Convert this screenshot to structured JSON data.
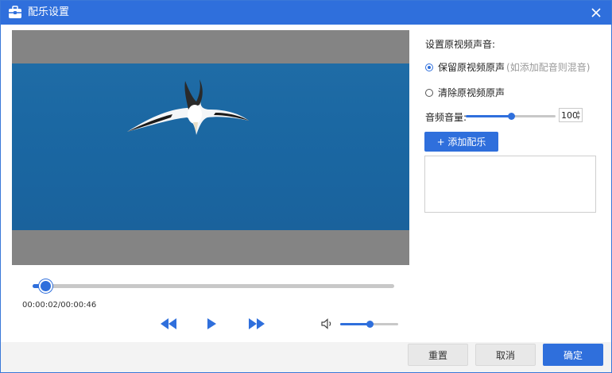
{
  "window": {
    "title": "配乐设置",
    "accent_color": "#2f6fdc"
  },
  "player": {
    "time_label": "00:00:02/00:00:46",
    "progress_fraction": 0.035,
    "volume_fraction": 0.5,
    "icons": [
      "rewind-icon",
      "play-icon",
      "fast-forward-icon",
      "volume-icon"
    ]
  },
  "settings": {
    "section_title": "设置原视频声音:",
    "option_keep": "保留原视频原声",
    "option_keep_hint": "(如添加配音则混音)",
    "option_clear": "清除原视频原声",
    "selected_option": "option_keep",
    "volume_label": "音频音量:",
    "volume_value": "100",
    "volume_fraction": 0.5,
    "add_music_label": "+ 添加配乐"
  },
  "footer": {
    "reset_label": "重置",
    "cancel_label": "取消",
    "ok_label": "确定"
  }
}
